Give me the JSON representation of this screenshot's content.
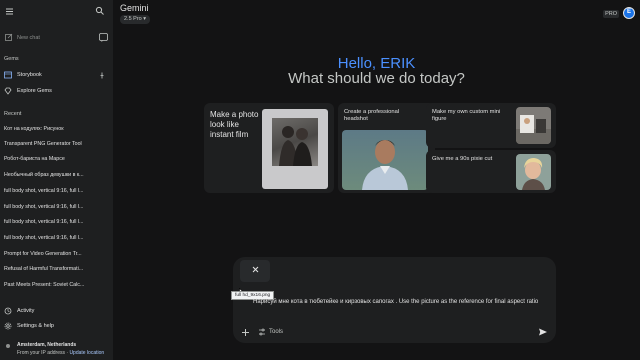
{
  "sidebar": {
    "new_chat": "New chat",
    "gems_label": "Gems",
    "gems": [
      {
        "label": "Storybook",
        "icon": "storybook-icon",
        "pinned": true
      },
      {
        "label": "Explore Gems",
        "icon": "diamond-icon",
        "pinned": false
      }
    ],
    "recent_label": "Recent",
    "recent": [
      "Кот на кодулях: Рисунок",
      "Transparent PNG Generator Tool",
      "Робот-бариста на Марсе",
      "Необычный образ девушки в к...",
      "full body shot, vertical 9:16, full l...",
      "full body shot, vertical 9:16, full l...",
      "full body shot, vertical 9:16, full l...",
      "full body shot, vertical 9:16, full l...",
      "Prompt for Video Generation Tr...",
      "Refusal of Harmful Transformati...",
      "Past Meets Present: Soviet Calc..."
    ],
    "activity": "Activity",
    "settings": "Settings & help",
    "location_name": "Amsterdam, Netherlands",
    "location_sub": "From your IP address",
    "location_sep": " · ",
    "location_link": "Update location"
  },
  "header": {
    "brand": "Gemini",
    "model": "2.5 Pro ▾",
    "pro_badge": "PRO",
    "avatar_initial": "E"
  },
  "greeting": {
    "hello": "Hello, ERIK",
    "question": "What should we do today?"
  },
  "cards": [
    {
      "title": "Make a photo look like instant film"
    },
    {
      "title": "Create a professional headshot"
    },
    {
      "title": "Make my own custom mini figure"
    },
    {
      "title": "Give me a 90s pixie cut"
    }
  ],
  "composer": {
    "attachment_tooltip": "full hd_9x16.png",
    "prompt_text": "Нарисуй мне кота в тюбетейке и кирзовых сапогах . Use the picture as the reference for final aspect ratio",
    "tools_label": "Tools"
  },
  "colors": {
    "accent": "#4b90ff",
    "avatar": "#1a73e8",
    "background": "#131314",
    "sidebar": "#1e1f20"
  }
}
